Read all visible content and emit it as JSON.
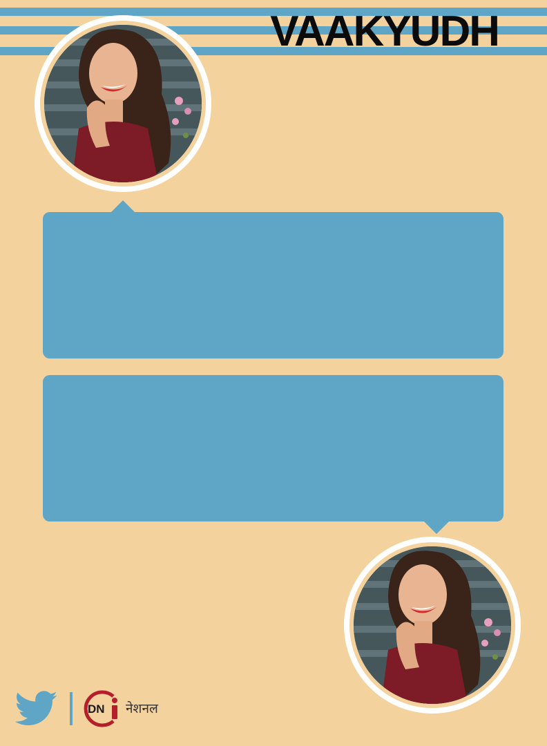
{
  "header": {
    "title": "VAAKYUDH"
  },
  "bubbles": {
    "top_text": "",
    "bottom_text": ""
  },
  "footer": {
    "social_icon": "twitter-bird-icon",
    "logo_letters": "DN",
    "logo_i": "i",
    "brand_label": "नेशनल"
  },
  "colors": {
    "background": "#f4d29e",
    "accent_blue": "#5ea5c6",
    "title_text": "#0b0b0b",
    "logo_red": "#b51f2b"
  },
  "images": {
    "avatar_top": "portrait-photo-woman-red-dress",
    "avatar_bottom": "portrait-photo-woman-red-dress"
  }
}
